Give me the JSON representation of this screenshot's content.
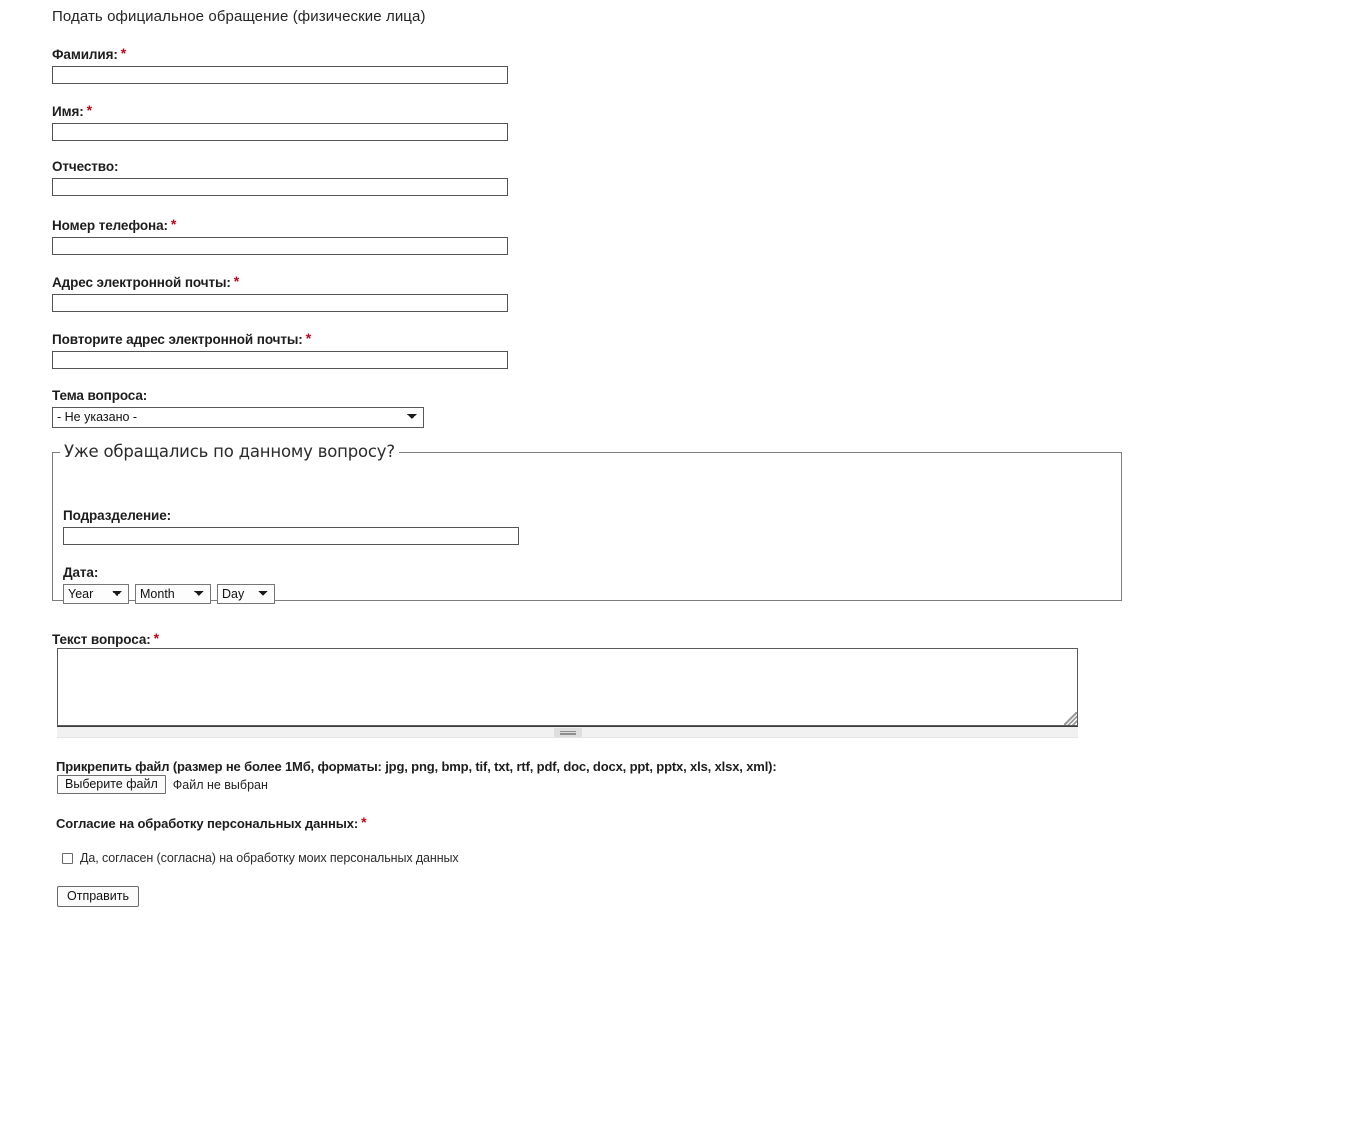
{
  "form": {
    "title": "Подать официальное обращение (физические лица)",
    "required_marker": "*",
    "required_marker_color": "#c00418",
    "fields": {
      "last_name": {
        "label": "Фамилия:",
        "required": true,
        "value": "",
        "placeholder": ""
      },
      "first_name": {
        "label": "Имя:",
        "required": true,
        "value": "",
        "placeholder": ""
      },
      "middle_name": {
        "label": "Отчество:",
        "required": false,
        "value": "",
        "placeholder": ""
      },
      "phone": {
        "label": "Номер телефона:",
        "required": true,
        "value": "",
        "placeholder": ""
      },
      "email": {
        "label": "Адрес электронной почты:",
        "required": true,
        "value": "",
        "placeholder": ""
      },
      "email_repeat": {
        "label": "Повторите адрес электронной почты:",
        "required": true,
        "value": "",
        "placeholder": ""
      },
      "topic": {
        "label": "Тема вопроса:",
        "required": false,
        "selected": "- Не указано -",
        "options": [
          "- Не указано -"
        ]
      },
      "question_text": {
        "label": "Текст вопроса:",
        "required": true,
        "value": "",
        "placeholder": ""
      }
    },
    "previous_request_group": {
      "legend": "Уже обращались по данному вопросу?",
      "department": {
        "label": "Подразделение:",
        "required": false,
        "value": "",
        "placeholder": ""
      },
      "date": {
        "label": "Дата:",
        "year": {
          "selected": "Year",
          "options": [
            "Year"
          ]
        },
        "month": {
          "selected": "Month",
          "options": [
            "Month"
          ]
        },
        "day": {
          "selected": "Day",
          "options": [
            "Day"
          ]
        }
      }
    },
    "attachment": {
      "label": "Прикрепить файл (размер не более 1Мб, форматы: jpg, png, bmp, tif, txt, rtf, pdf, doc, docx, ppt, pptx, xls, xlsx, xml):",
      "button_label": "Выберите файл",
      "status": "Файл не выбран"
    },
    "consent": {
      "label": "Согласие на обработку персональных данных:",
      "required": true,
      "checkbox_text": "Да, согласен (согласна) на обработку моих персональных данных",
      "checked": false
    },
    "submit_label": "Отправить"
  }
}
